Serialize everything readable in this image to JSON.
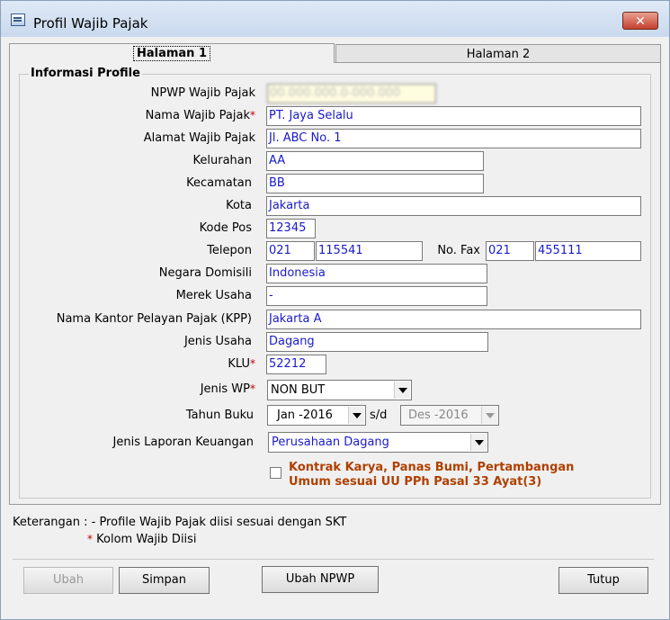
{
  "window": {
    "title": "Profil Wajib Pajak",
    "close_glyph": "✕"
  },
  "tabs": [
    {
      "label": "Halaman 1",
      "active": true
    },
    {
      "label": "Halaman 2",
      "active": false
    }
  ],
  "group": {
    "title": "Informasi Profile"
  },
  "form": {
    "npwp": {
      "label": "NPWP Wajib Pajak",
      "value": "00.000.000.0-000.000"
    },
    "nama": {
      "label": "Nama Wajib Pajak",
      "required_mark": "*",
      "value": "PT. Jaya Selalu"
    },
    "alamat": {
      "label": "Alamat Wajib Pajak",
      "value": "Jl. ABC No. 1"
    },
    "kelurahan": {
      "label": "Kelurahan",
      "value": "AA"
    },
    "kecamatan": {
      "label": "Kecamatan",
      "value": "BB"
    },
    "kota": {
      "label": "Kota",
      "value": "Jakarta"
    },
    "kode_pos": {
      "label": "Kode Pos",
      "value": "12345"
    },
    "telepon": {
      "label": "Telepon",
      "area": "021",
      "number": "115541"
    },
    "fax": {
      "label": "No. Fax",
      "area": "021",
      "number": "455111"
    },
    "negara": {
      "label": "Negara Domisili",
      "value": "Indonesia"
    },
    "merek": {
      "label": "Merek Usaha",
      "value": "-"
    },
    "kpp": {
      "label": "Nama Kantor Pelayan Pajak (KPP)",
      "value": "Jakarta A"
    },
    "jenis_usaha": {
      "label": "Jenis Usaha",
      "value": "Dagang"
    },
    "klu": {
      "label": "KLU",
      "required_mark": "*",
      "value": "52212"
    },
    "jenis_wp": {
      "label": "Jenis WP",
      "required_mark": "*",
      "value": "NON BUT"
    },
    "tahun_buku": {
      "label": "Tahun Buku",
      "start": "Jan  -2016",
      "separator": "s/d",
      "end": "Des -2016"
    },
    "laporan": {
      "label": "Jenis Laporan Keuangan",
      "value": "Perusahaan Dagang"
    },
    "kontrak": {
      "checked": false,
      "line1": "Kontrak Karya,  Panas Bumi, Pertambangan",
      "line2": "Umum sesuai UU PPh Pasal 33 Ayat(3)"
    }
  },
  "notes": {
    "line1": "Keterangan : - Profile Wajib Pajak diisi sesuai dengan SKT",
    "line2_mark": "*",
    "line2": "Kolom Wajib Diisi"
  },
  "buttons": {
    "ubah": "Ubah",
    "simpan": "Simpan",
    "ubah_npwp": "Ubah NPWP",
    "tutup": "Tutup"
  },
  "colors": {
    "field_text": "#1a1ac8",
    "required": "#c00000",
    "checkbox_label": "#b04000"
  }
}
